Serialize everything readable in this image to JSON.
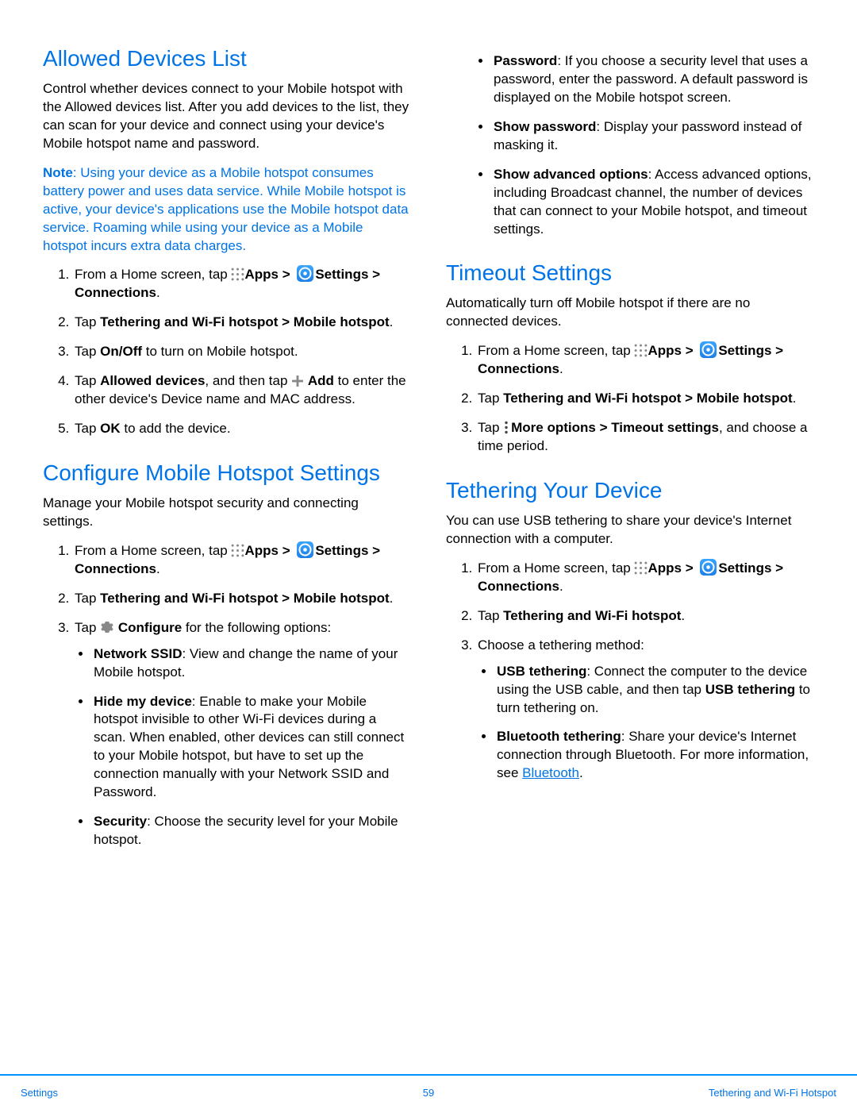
{
  "allowed": {
    "heading": "Allowed Devices List",
    "intro": "Control whether devices connect to your Mobile hotspot with the Allowed devices list. After you add devices to the list, they can scan for your device and connect using your device's Mobile hotspot name and password.",
    "note_label": "Note",
    "note_body": ": Using your device as a Mobile hotspot consumes battery power and uses data service. While Mobile hotspot is active, your device's applications use the Mobile hotspot data service. Roaming while using your device as a Mobile hotspot incurs extra data charges.",
    "step1_prefix": "From a Home screen, tap ",
    "apps_label": "Apps > ",
    "settings_label": "Settings > Connections",
    "step1_suffix": ".",
    "step2_prefix": "Tap ",
    "step2_bold": "Tethering and Wi-Fi hotspot > Mobile hotspot",
    "step2_suffix": ".",
    "step3_prefix": "Tap ",
    "step3_bold": "On/Off",
    "step3_suffix": " to turn on Mobile hotspot.",
    "step4_prefix": "Tap ",
    "step4_bold1": "Allowed devices",
    "step4_mid": ", and then tap ",
    "step4_bold2": "Add",
    "step4_suffix": " to enter the other device's Device name and MAC address.",
    "step5_prefix": "Tap ",
    "step5_bold": "OK",
    "step5_suffix": " to add the device."
  },
  "configure": {
    "heading": "Configure Mobile Hotspot Settings",
    "intro": "Manage your Mobile hotspot security and connecting settings.",
    "step3_prefix": "Tap ",
    "step3_bold": "Configure",
    "step3_suffix": " for the following options:",
    "opt1_bold": "Network SSID",
    "opt1_text": ": View and change the name of your Mobile hotspot.",
    "opt2_bold": "Hide my device",
    "opt2_text": ": Enable to make your Mobile hotspot invisible to other Wi-Fi devices during a scan. When enabled, other devices can still connect to your Mobile hotspot, but have to set up the connection manually with your Network SSID and Password.",
    "opt3_bold": "Security",
    "opt3_text": ": Choose the security level for your Mobile hotspot.",
    "opt4_bold": "Password",
    "opt4_text": ": If you choose a security level that uses a password, enter the password. A default password is displayed on the Mobile hotspot screen.",
    "opt5_bold": "Show password",
    "opt5_text": ": Display your password instead of masking it.",
    "opt6_bold": "Show advanced options",
    "opt6_text": ": Access advanced options, including Broadcast channel, the number of devices that can connect to your Mobile hotspot, and timeout settings."
  },
  "timeout": {
    "heading": "Timeout Settings",
    "intro": "Automatically turn off Mobile hotspot if there are no connected devices.",
    "step3_prefix": "Tap ",
    "step3_bold": "More options > Timeout settings",
    "step3_suffix": ", and choose a time period."
  },
  "tethering": {
    "heading": "Tethering Your Device",
    "intro": "You can use USB tethering to share your device's Internet connection with a computer.",
    "step2_prefix": "Tap ",
    "step2_bold": "Tethering and Wi-Fi hotspot",
    "step2_suffix": ".",
    "step3": "Choose a tethering method:",
    "opt1_bold": "USB tethering",
    "opt1_text1": ": Connect the computer to the device using the USB cable, and then tap ",
    "opt1_bold2": "USB tethering",
    "opt1_text2": " to turn tethering on.",
    "opt2_bold": "Bluetooth tethering",
    "opt2_text1": ": Share your device's Internet connection through Bluetooth. For more information, see ",
    "opt2_link": "Bluetooth",
    "opt2_text2": "."
  },
  "footer": {
    "left": "Settings",
    "center": "59",
    "right": "Tethering and Wi-Fi Hotspot"
  }
}
